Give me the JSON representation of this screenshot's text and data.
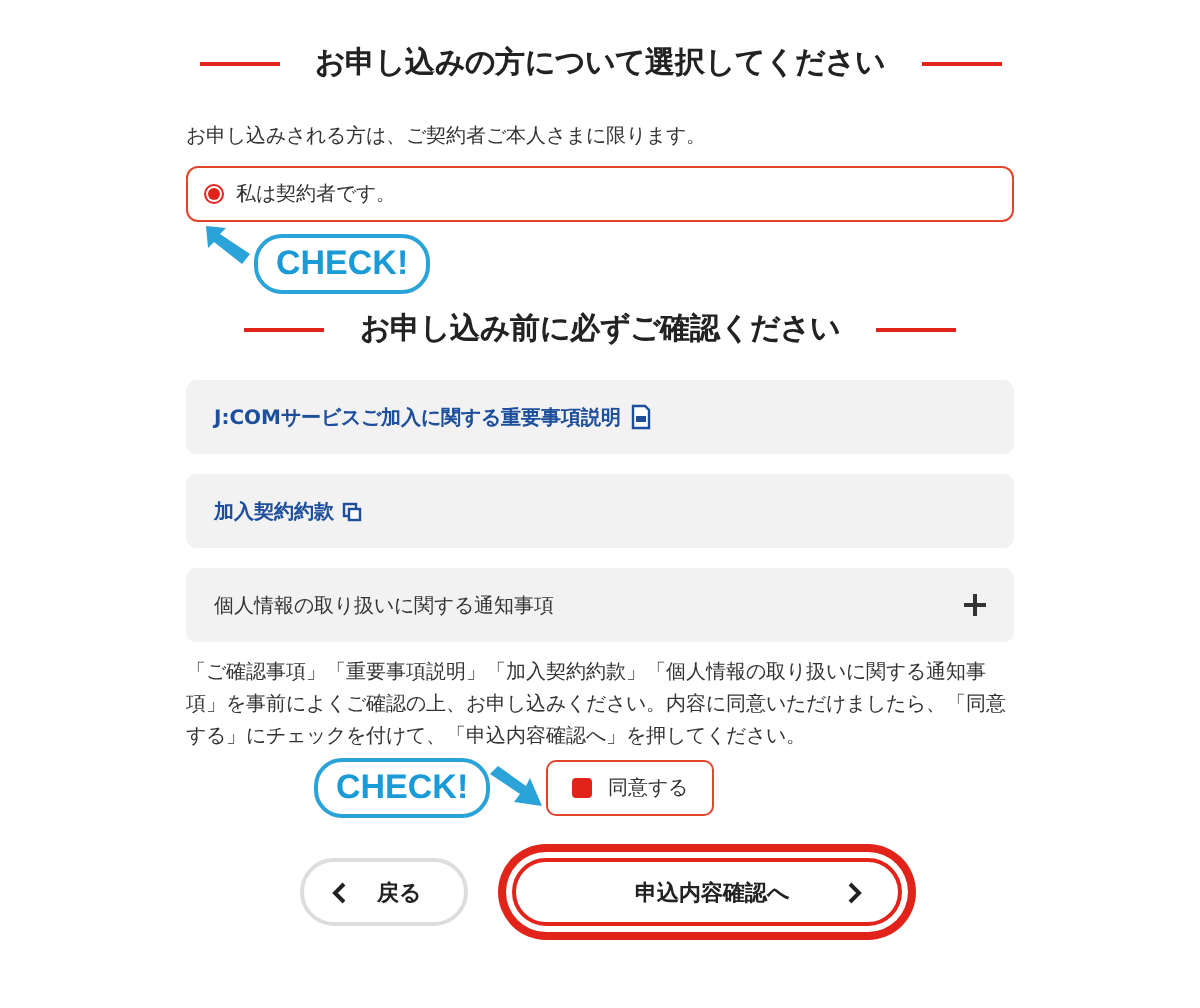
{
  "applicant": {
    "heading": "お申し込みの方について選択してください",
    "note": "お申し込みされる方は、ご契約者ご本人さまに限ります。",
    "options": [
      {
        "label": "私は契約者です。",
        "selected": true
      }
    ],
    "callout": "CHECK!"
  },
  "confirm": {
    "heading": "お申し込み前に必ずご確認ください",
    "documents": [
      {
        "kind": "pdf",
        "label": "J:COMサービスご加入に関する重要事項説明"
      },
      {
        "kind": "external",
        "label": "加入契約約款"
      },
      {
        "kind": "expandable",
        "label": "個人情報の取り扱いに関する通知事項",
        "expanded": false
      }
    ],
    "instructions": "「ご確認事項」「重要事項説明」「加入契約約款」「個人情報の取り扱いに関する通知事項」を事前によくご確認の上、お申し込みください。内容に同意いただけましたら、「同意する」にチェックを付けて、「申込内容確認へ」を押してください。",
    "callout": "CHECK!",
    "agree": {
      "label": "同意する",
      "checked": true
    }
  },
  "buttons": {
    "back": "戻る",
    "next": "申込内容確認へ"
  }
}
